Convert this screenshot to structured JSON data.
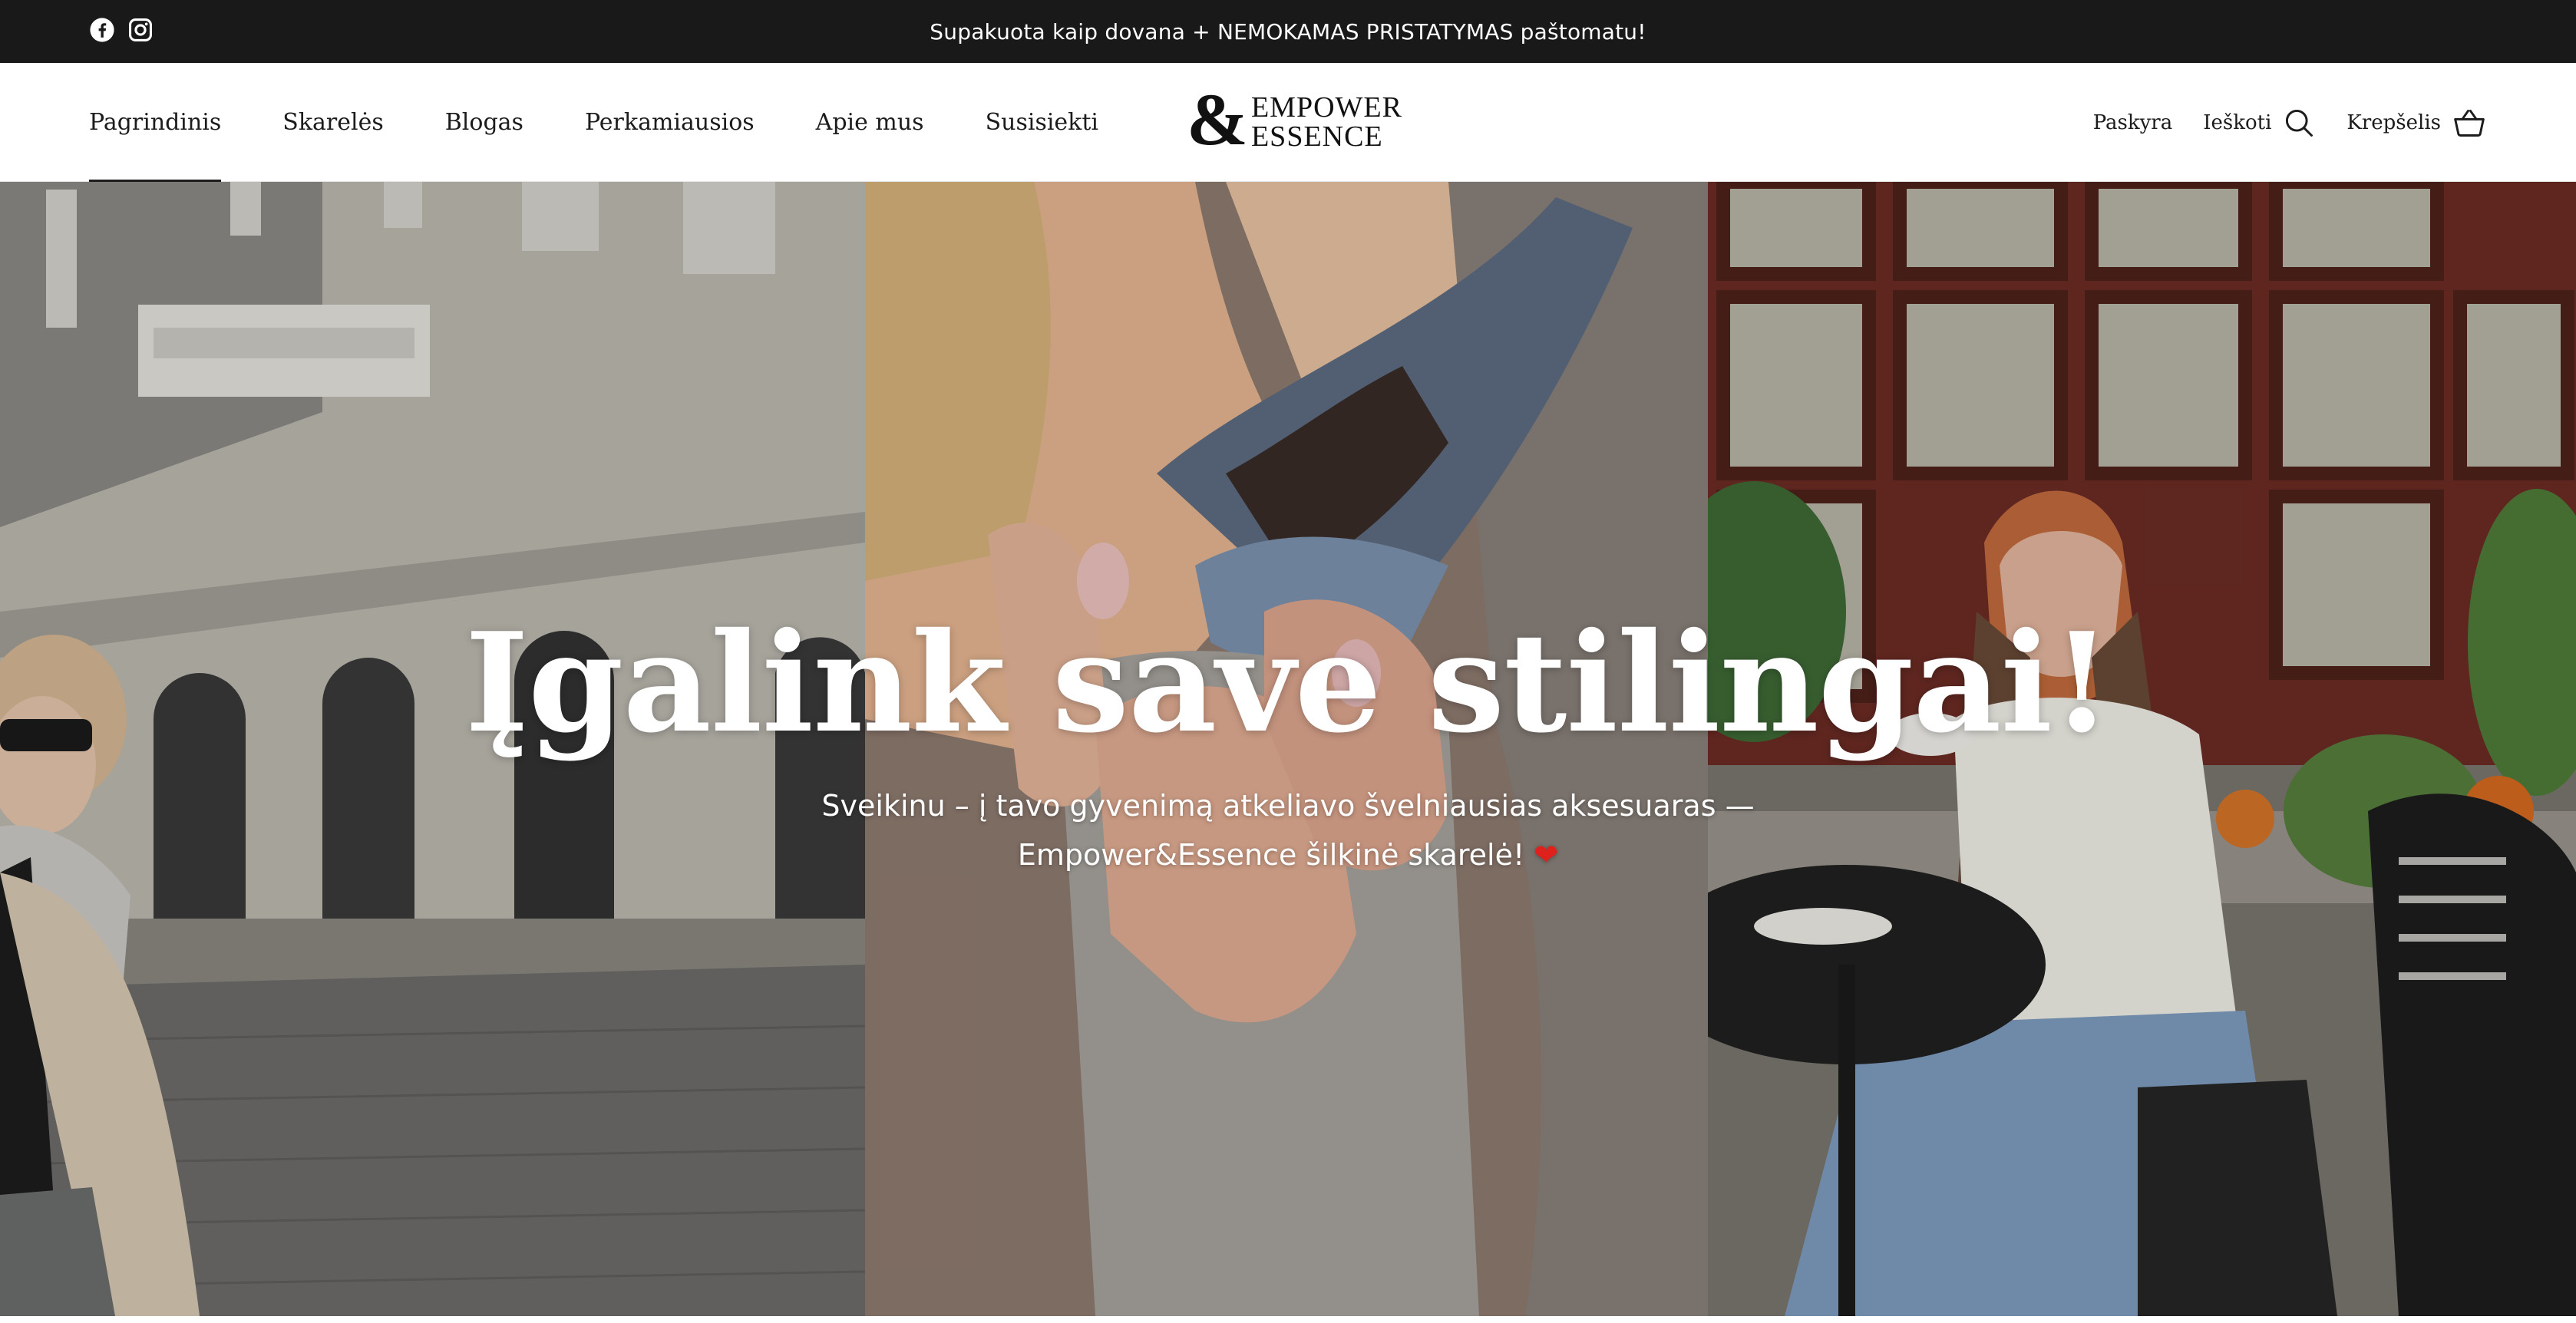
{
  "announcement": {
    "text": "Supakuota kaip dovana + NEMOKAMAS PRISTATYMAS paštomatu!",
    "social": [
      "facebook-icon",
      "instagram-icon"
    ]
  },
  "header": {
    "nav": [
      {
        "label": "Pagrindinis",
        "active": true
      },
      {
        "label": "Skarelės"
      },
      {
        "label": "Blogas"
      },
      {
        "label": "Perkamiausios"
      },
      {
        "label": "Apie mus"
      },
      {
        "label": "Susisiekti"
      }
    ],
    "logo": {
      "amp": "&",
      "line1": "EMPOWER",
      "line2": "ESSENCE"
    },
    "account_label": "Paskyra",
    "search_label": "Ieškoti",
    "cart_label": "Krepšelis"
  },
  "hero": {
    "title": "Įgalink save stilingai!",
    "subtitle": "Sveikinu – į tavo gyvenimą atkeliavo švelniausias aksesuaras — Empower&Essence šilkinė skarelė!",
    "heart": "❤"
  },
  "colors": {
    "announcement_bg": "#191919",
    "text_dark": "#1c1c1c",
    "heart": "#e0201b"
  }
}
